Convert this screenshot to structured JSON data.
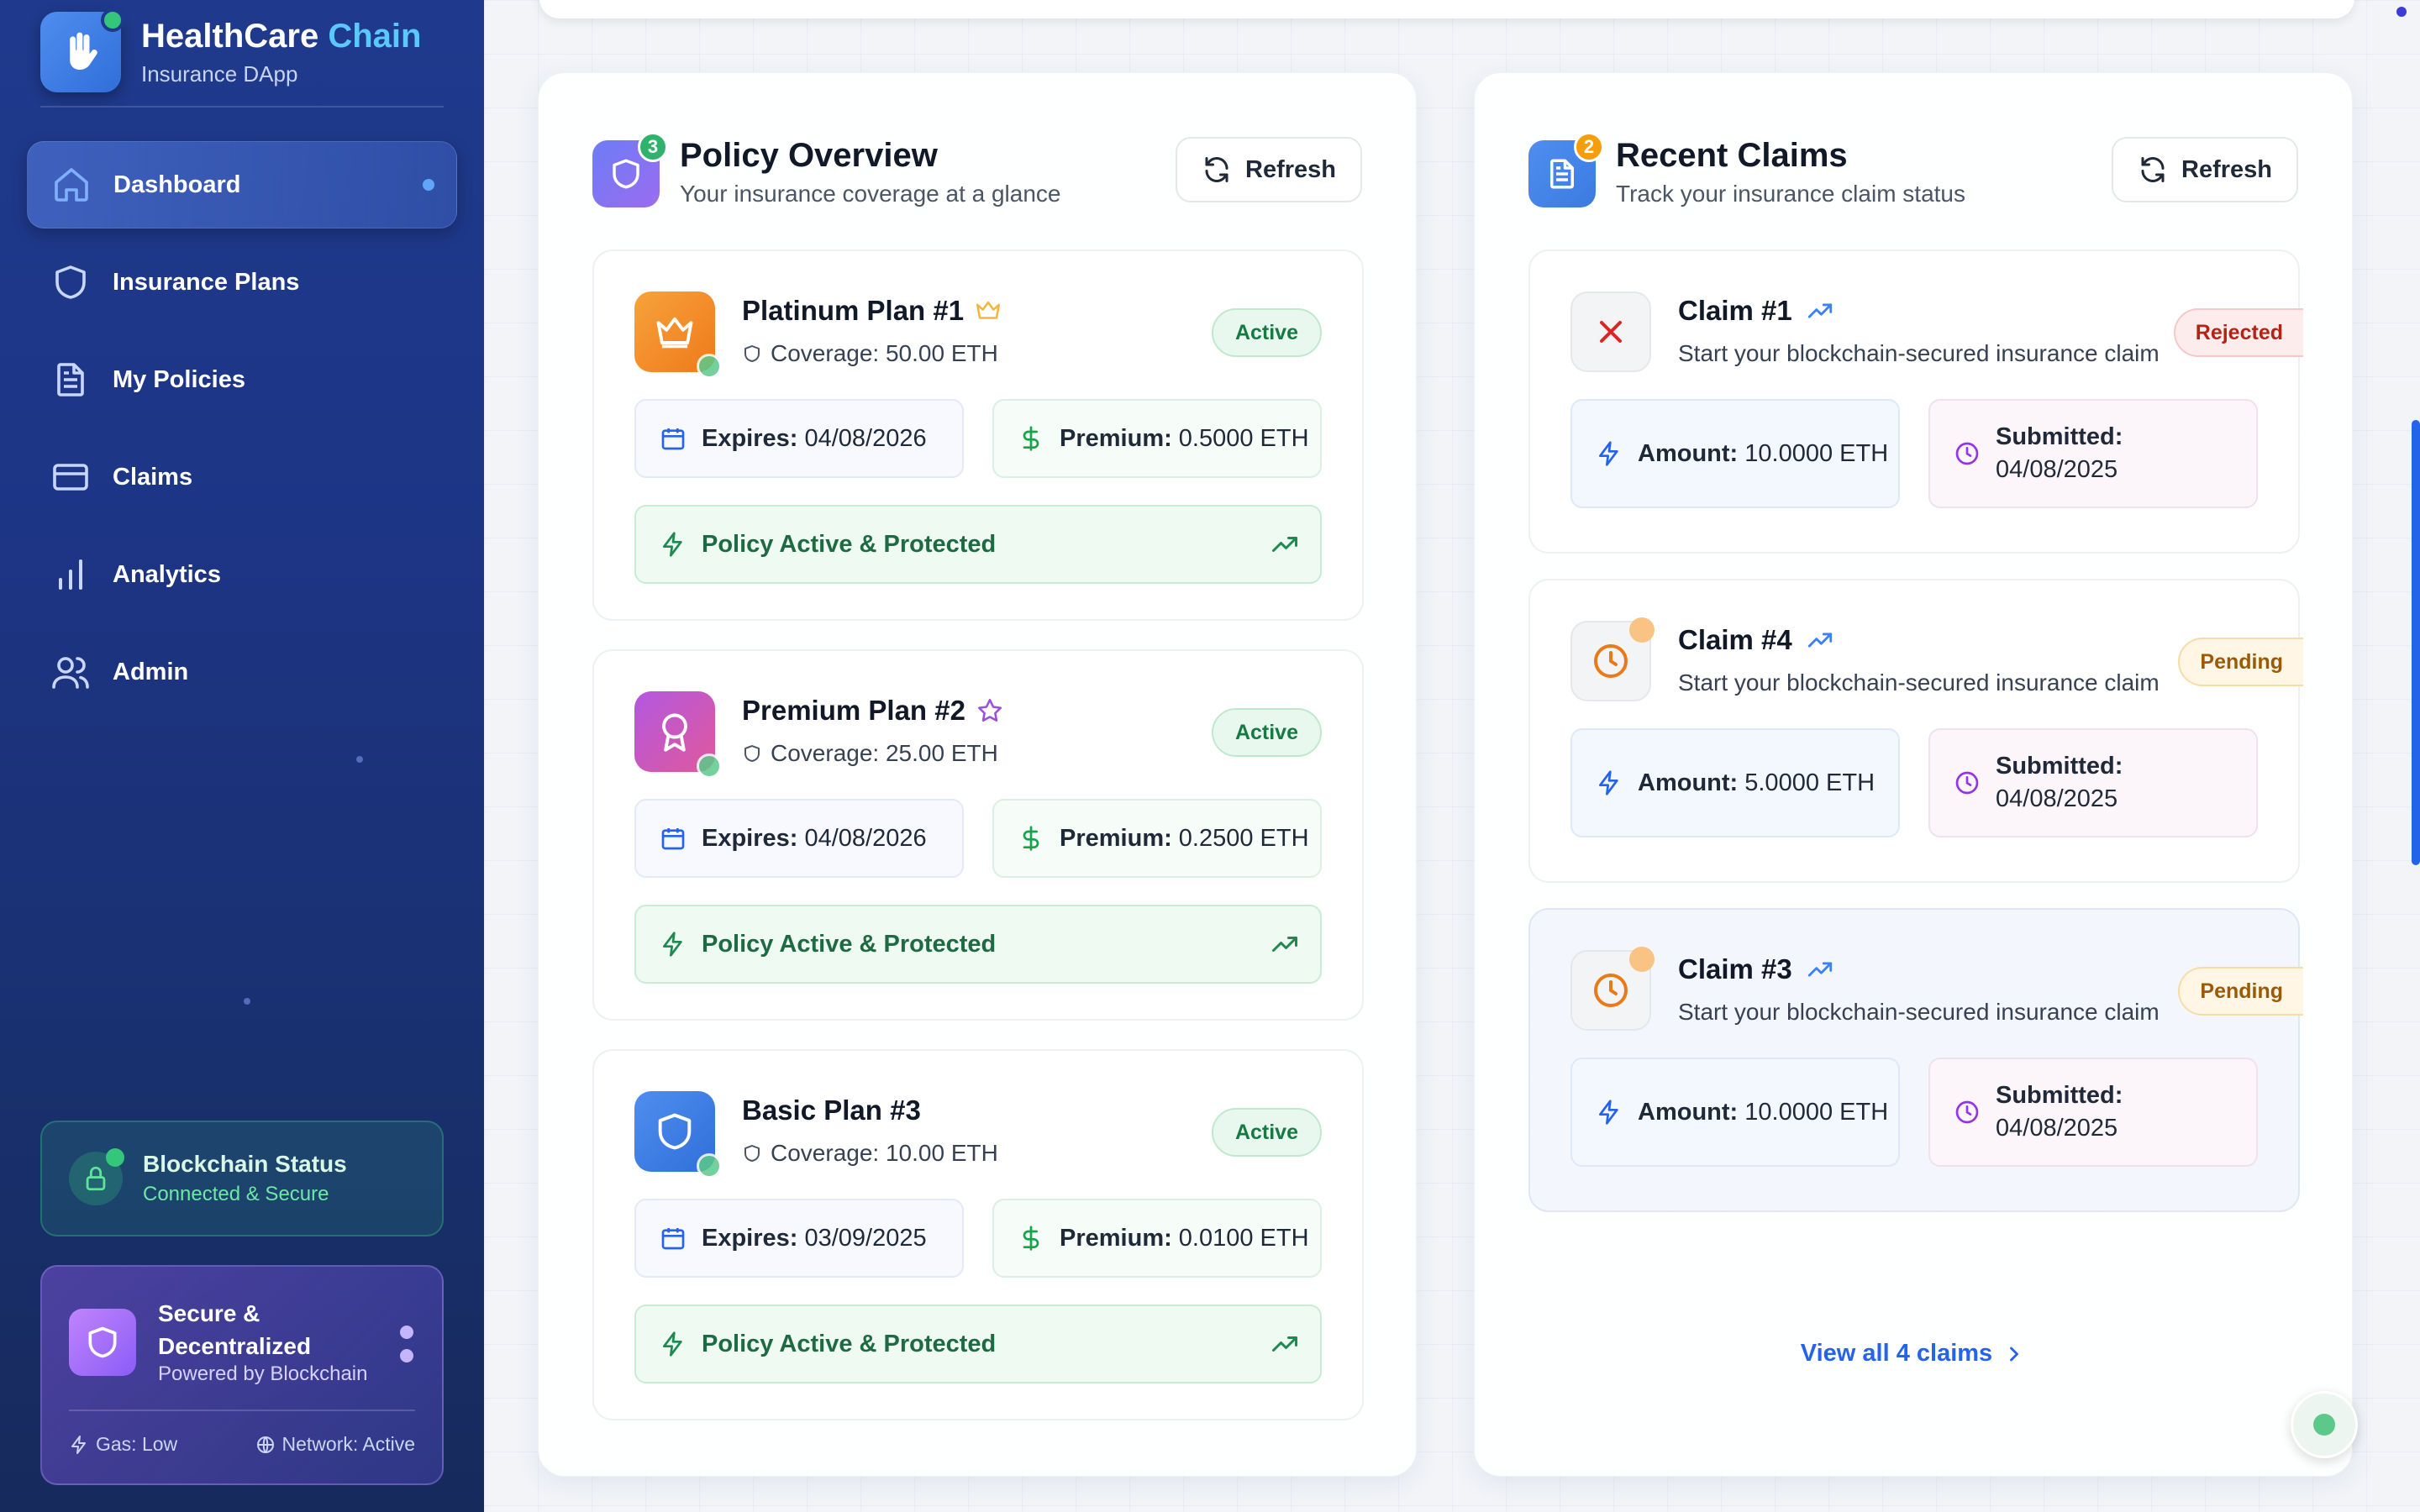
{
  "app": {
    "title_main": "HealthCare",
    "title_accent": "Chain",
    "subtitle": "Insurance DApp"
  },
  "sidebar": {
    "items": [
      {
        "label": "Dashboard",
        "icon": "home-icon",
        "active": true
      },
      {
        "label": "Insurance Plans",
        "icon": "shield-icon"
      },
      {
        "label": "My Policies",
        "icon": "document-icon"
      },
      {
        "label": "Claims",
        "icon": "credit-card-icon"
      },
      {
        "label": "Analytics",
        "icon": "bar-chart-icon"
      },
      {
        "label": "Admin",
        "icon": "users-icon"
      }
    ],
    "blockchain_status": {
      "title": "Blockchain Status",
      "subtitle": "Connected & Secure"
    },
    "secure": {
      "title": "Secure & Decentralized",
      "subtitle": "Powered by Blockchain",
      "gas": "Gas: Low",
      "network": "Network: Active"
    }
  },
  "policy_panel": {
    "title": "Policy Overview",
    "subtitle": "Your insurance coverage at a glance",
    "badge": "3",
    "refresh_label": "Refresh",
    "policies": [
      {
        "name": "Platinum Plan #1",
        "coverage": "Coverage: 50.00 ETH",
        "status": "Active",
        "expires_label": "Expires:",
        "expires": "04/08/2026",
        "premium_label": "Premium:",
        "premium": "0.5000 ETH",
        "bar": "Policy Active & Protected",
        "icon": "crown-icon",
        "accent": "#f59e0b"
      },
      {
        "name": "Premium Plan #2",
        "coverage": "Coverage: 25.00 ETH",
        "status": "Active",
        "expires_label": "Expires:",
        "expires": "04/08/2026",
        "premium_label": "Premium:",
        "premium": "0.2500 ETH",
        "bar": "Policy Active & Protected",
        "icon": "award-icon",
        "accent": "#c04fd6"
      },
      {
        "name": "Basic Plan #3",
        "coverage": "Coverage: 10.00 ETH",
        "status": "Active",
        "expires_label": "Expires:",
        "expires": "03/09/2025",
        "premium_label": "Premium:",
        "premium": "0.0100 ETH",
        "bar": "Policy Active & Protected",
        "icon": "shield-icon",
        "accent": "#3b82f6"
      }
    ]
  },
  "claims_panel": {
    "title": "Recent Claims",
    "subtitle": "Track your insurance claim status",
    "badge": "2",
    "refresh_label": "Refresh",
    "claims": [
      {
        "name": "Claim #1",
        "desc": "Start your blockchain-secured insurance claim",
        "status": "Rejected",
        "amount_label": "Amount:",
        "amount": "10.0000 ETH",
        "submitted_label": "Submitted:",
        "submitted": "04/08/2025"
      },
      {
        "name": "Claim #4",
        "desc": "Start your blockchain-secured insurance claim",
        "status": "Pending",
        "amount_label": "Amount:",
        "amount": "5.0000 ETH",
        "submitted_label": "Submitted:",
        "submitted": "04/08/2025"
      },
      {
        "name": "Claim #3",
        "desc": "Start your blockchain-secured insurance claim",
        "status": "Pending",
        "amount_label": "Amount:",
        "amount": "10.0000 ETH",
        "submitted_label": "Submitted:",
        "submitted": "04/08/2025"
      }
    ],
    "view_all": "View all 4 claims"
  },
  "colors": {
    "sidebar_bg": "#1f3a8c",
    "accent_blue": "#2563eb",
    "active_green": "#177a44",
    "rejected_red": "#b42318",
    "pending_amber": "#9a5b06"
  }
}
